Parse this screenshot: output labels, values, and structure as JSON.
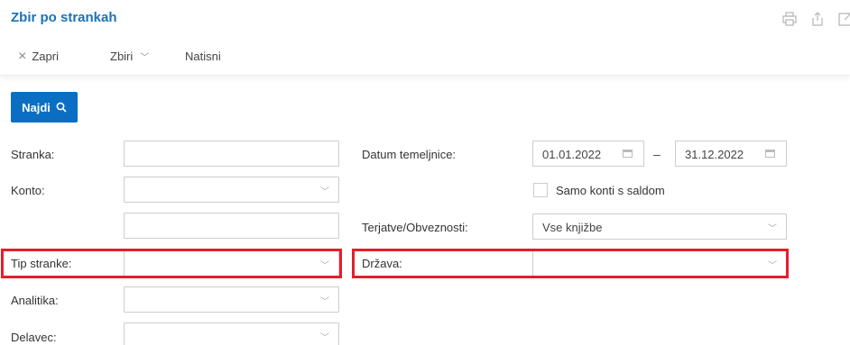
{
  "header": {
    "title": "Zbir po strankah",
    "icons": [
      "print-icon",
      "share-icon",
      "export-icon"
    ]
  },
  "toolbar": {
    "close_label": "Zapri",
    "sums_label": "Zbiri",
    "print_label": "Natisni"
  },
  "find_button": {
    "label": "Najdi"
  },
  "form": {
    "stranka_label": "Stranka:",
    "stranka_value": "",
    "konto_label": "Konto:",
    "konto_value": "",
    "konto2_value": "",
    "tip_stranke_label": "Tip stranke:",
    "tip_stranke_value": "",
    "analitika_label": "Analitika:",
    "analitika_value": "",
    "delavec_label": "Delavec:",
    "delavec_value": "",
    "datum_label": "Datum temeljnice:",
    "datum_from": "01.01.2022",
    "datum_separator": "–",
    "datum_to": "31.12.2022",
    "samo_konti_label": "Samo konti s saldom",
    "samo_konti_checked": false,
    "terjatve_label": "Terjatve/Obveznosti:",
    "terjatve_value": "Vse knjižbe",
    "drzava_label": "Država:",
    "drzava_value": ""
  },
  "colors": {
    "accent": "#1a73b5",
    "button": "#0a6fc2",
    "highlight": "#e2202c"
  }
}
